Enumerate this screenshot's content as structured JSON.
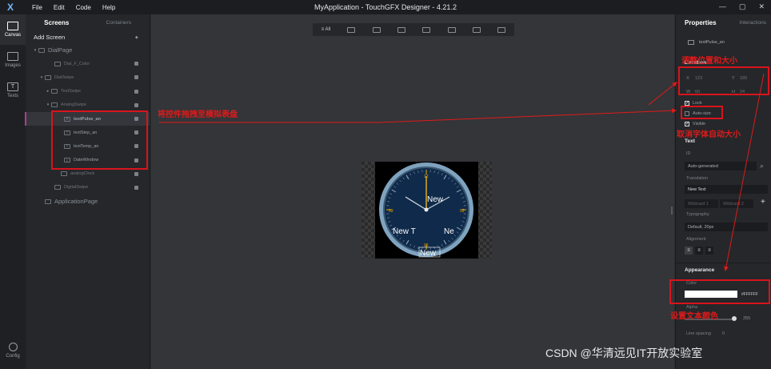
{
  "titlebar": {
    "menu": [
      "File",
      "Edit",
      "Code",
      "Help"
    ],
    "title": "MyApplication - TouchGFX Designer - 4.21.2",
    "controls": [
      "—",
      "▢",
      "✕"
    ]
  },
  "iconbar": {
    "items": [
      {
        "label": "Canvas",
        "icon": "canvas-icon"
      },
      {
        "label": "Images",
        "icon": "images-icon"
      },
      {
        "label": "Texts",
        "icon": "texts-icon",
        "glyph": "T"
      }
    ],
    "config_label": "Config"
  },
  "tree": {
    "tab_screens": "Screens",
    "tab_containers": "Containers",
    "add_screen": "Add Screen",
    "add_glyph": "+",
    "nodes": [
      {
        "label": "DialPage",
        "caret": "▾",
        "indent": 8
      },
      {
        "label": "Dial_F_Color",
        "indent": 28
      },
      {
        "label": "DialSwipe",
        "caret": "▾",
        "indent": 16
      },
      {
        "label": "TextSwipe",
        "caret": "▸",
        "indent": 24
      },
      {
        "label": "AnalogSwipe",
        "caret": "▾",
        "indent": 24
      },
      {
        "label": "textPulse_an",
        "indent": 40,
        "selected": true,
        "icon": "T"
      },
      {
        "label": "textStep_an",
        "indent": 40,
        "icon": "T"
      },
      {
        "label": "textTemp_an",
        "indent": 40,
        "icon": "T"
      },
      {
        "label": "DateWindow",
        "indent": 40,
        "icon": "T"
      },
      {
        "label": "analogClock",
        "indent": 36
      },
      {
        "label": "DigitalSwipe",
        "indent": 28
      },
      {
        "label": "ApplicationPage",
        "indent": 16
      }
    ]
  },
  "canvas": {
    "toolbar_all": "≡ All",
    "clock": {
      "texts": [
        "New",
        "New T",
        "Ne",
        "New"
      ],
      "ticks": [
        "12",
        "09",
        "03",
        "06"
      ],
      "colors": {
        "face": "#0f2a4a",
        "ring": "#7fa3bf",
        "accent": "#f0a800",
        "hand": "#f0b020"
      }
    }
  },
  "properties": {
    "tab_properties": "Properties",
    "tab_interactions": "Interactions",
    "widget_name": "textPulse_an",
    "location_label": "Location",
    "x_label": "X",
    "x_value": "123",
    "y_label": "Y",
    "y_value": "180",
    "w_label": "W",
    "w_value": "60",
    "h_label": "H",
    "h_value": "24",
    "lock_label": "Lock",
    "autosize_label": "Auto-size",
    "visible_label": "Visible",
    "check_glyph": "✓",
    "text_section": "Text",
    "id_label": "ID",
    "id_value": "Auto-generated",
    "search_glyph": "⌕",
    "translation_label": "Translation",
    "translation_value": "New Text",
    "wildcard1": "Wildcard 1",
    "wildcard2": "Wildcard 2",
    "add_glyph": "+",
    "typography_label": "Typography",
    "typography_value": "Default, 20px",
    "alignment_label": "Alignment",
    "align_glyph": "≡",
    "appearance_section": "Appearance",
    "color_label": "Color",
    "color_value": "#FFFFFF",
    "alpha_label": "Alpha",
    "alpha_value": "255",
    "line_spacing_label": "Line spacing",
    "line_spacing_value": "0"
  },
  "annotations": {
    "drag": "将控件拖拽至模拟表盘",
    "position": "调整位置和大小",
    "autosize": "取消字体自动大小",
    "color": "设置文本颜色",
    "accent": "#d8141c"
  },
  "watermark": "CSDN @华清远见IT开放实验室"
}
